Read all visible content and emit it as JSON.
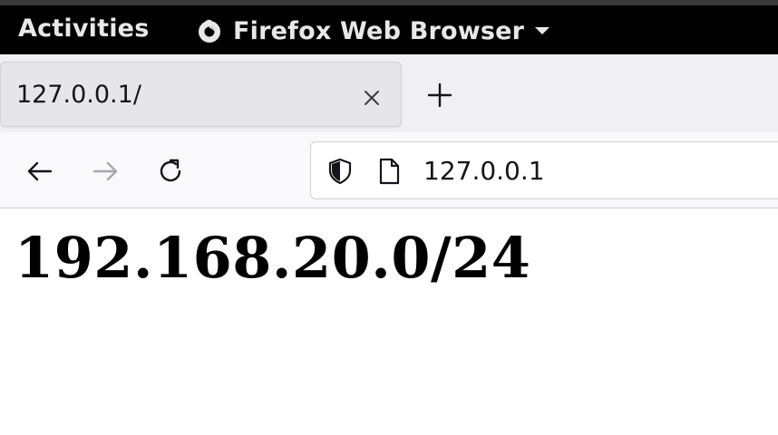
{
  "topbar": {
    "activities_label": "Activities",
    "app_menu_label": "Firefox Web Browser",
    "app_icon": "firefox-icon",
    "dropdown_icon": "caret-down-icon"
  },
  "tabs": [
    {
      "title": "127.0.0.1/",
      "active": true,
      "close_icon": "close-icon"
    }
  ],
  "new_tab_icon": "plus-icon",
  "navigation": {
    "back_icon": "arrow-left-icon",
    "forward_icon": "arrow-right-icon",
    "forward_enabled": false,
    "reload_icon": "reload-icon"
  },
  "urlbar": {
    "security_icon": "shield-icon",
    "page_icon": "page-icon",
    "url": "127.0.0.1"
  },
  "page": {
    "heading": "192.168.20.0/24"
  },
  "colors": {
    "topbar_bg": "#000000",
    "tabstrip_bg": "#f0f0f4",
    "active_tab_bg": "#e6e6e9",
    "toolbar_bg": "#f9f9fb",
    "text": "#15141a",
    "disabled_icon": "#a8a8ae"
  }
}
